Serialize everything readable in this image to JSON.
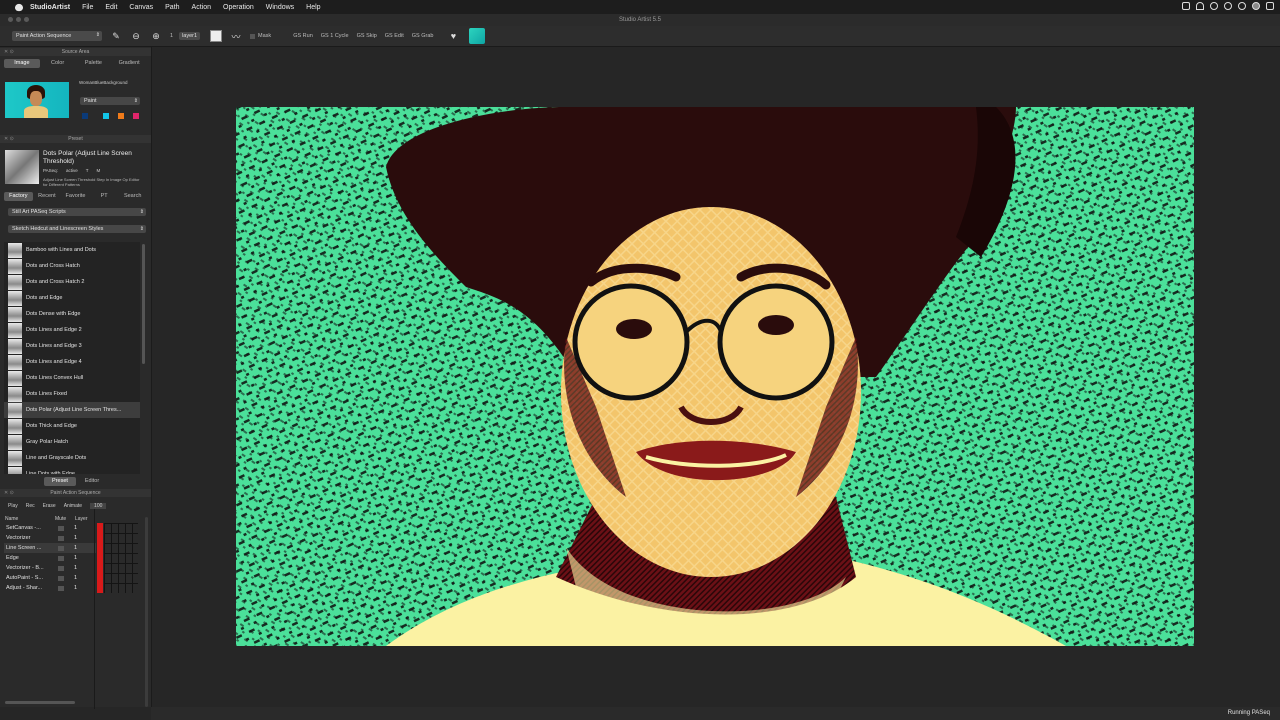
{
  "menubar": {
    "app_name": "StudioArtist",
    "items": [
      "File",
      "Edit",
      "Canvas",
      "Path",
      "Action",
      "Operation",
      "Windows",
      "Help"
    ]
  },
  "window": {
    "title": "Studio Artist 5.5"
  },
  "toolbar": {
    "op_select": "Paint Action Sequence",
    "brush_size": "1",
    "layer_select": "layer1",
    "mask_label": "Mask",
    "buttons": [
      "GS Run",
      "GS 1 Cycle",
      "GS Skip",
      "GS Edit",
      "GS Grab"
    ]
  },
  "source_area": {
    "title": "Source Area",
    "tabs": [
      "Image",
      "Color",
      "Palette",
      "Gradient"
    ],
    "image_name": "WomanBlueBackground",
    "mode_select": "Paint",
    "swatch_colors": [
      "#0b3a78",
      "#12c6e8",
      "#f07b1a",
      "#e0256b"
    ]
  },
  "preset": {
    "title": "Preset",
    "name": "Dots Polar (Adjust Line Screen Threshold)",
    "paseq_label": "PASeq:",
    "paseq_status": "active",
    "paseq_t": "T",
    "paseq_m": "M",
    "description": "Adjust Line Screen Threshold Step In Image Op Editor for Different Patterns",
    "tabs": [
      "Factory",
      "Recent",
      "Favorite",
      "PT",
      "Search"
    ],
    "category_select": "Still Art PASeq Scripts",
    "subcategory_select": "Sketch Hedcut and Linescreen Styles",
    "items": [
      "Bamboo with Lines and Dots",
      "Dots and Cross Hatch",
      "Dots and Cross Hatch 2",
      "Dots and Edge",
      "Dots Dense with Edge",
      "Dots Lines and Edge 2",
      "Dots Lines and Edge 3",
      "Dots Lines and Edge 4",
      "Dots Lines Convex Hull",
      "Dots Lines Fixed",
      "Dots Polar (Adjust Line Screen Thres...",
      "Dots Thick and Edge",
      "Gray Polar Hatch",
      "Line and Grayscale Dots",
      "Line Dots with Edge"
    ],
    "selected_index": 10,
    "bottom_tabs": [
      "Preset",
      "Editor"
    ]
  },
  "sequence": {
    "title": "Paint Action Sequence",
    "controls": [
      "Play",
      "Rec",
      "Erase",
      "Animate"
    ],
    "frames": "100",
    "columns": [
      "Name",
      "Mute",
      "Layer"
    ],
    "rows": [
      {
        "name": "SetCanvas -...",
        "layer": "1"
      },
      {
        "name": "Vectorizer",
        "layer": "1"
      },
      {
        "name": "Line Screen ...",
        "layer": "1"
      },
      {
        "name": "Edge",
        "layer": "1"
      },
      {
        "name": "Vectorizer - B...",
        "layer": "1"
      },
      {
        "name": "AutoPaint - S...",
        "layer": "1"
      },
      {
        "name": "Adjust - Shar...",
        "layer": "1"
      }
    ],
    "selected_index": 2
  },
  "status": {
    "text": "Running PASeq"
  },
  "colors": {
    "canvas_green": "#4be09a",
    "hair": "#2a0c0c",
    "skin": "#f3c56b",
    "shirt": "#fbf2a3",
    "accent_red": "#d81a1a"
  }
}
